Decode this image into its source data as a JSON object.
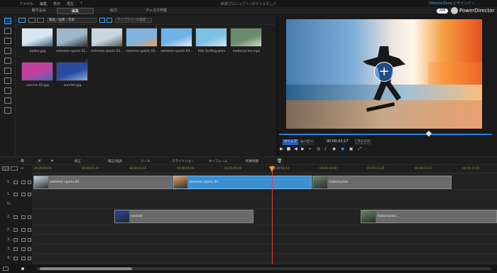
{
  "titlebar": {
    "menu": [
      "ファイル",
      "編集",
      "表示",
      "再生",
      "?"
    ],
    "title": "新規プロジェクト (タイトルなし)*",
    "directorzone": "DirectorZone にサインイン"
  },
  "modes": {
    "tabs": [
      "取り込み",
      "編集",
      "出力",
      "ディスク作成"
    ],
    "active": "編集"
  },
  "brand": {
    "badge": "APP",
    "name": "PowerDirector"
  },
  "library": {
    "filter": "動画・画像・音楽",
    "search_placeholder": "ライブラリーの検索",
    "items": [
      {
        "name": "ballon.jpg",
        "colors": [
          "#d8e6ef",
          "#3a5f7a"
        ],
        "check": false
      },
      {
        "name": "extreme sports 01...",
        "colors": [
          "#9bb7c8",
          "#303030"
        ],
        "check": false
      },
      {
        "name": "extreme sports 02...",
        "colors": [
          "#c8d6e0",
          "#5a5a4a"
        ],
        "check": false
      },
      {
        "name": "extreme sports 03...",
        "colors": [
          "#7fb3e0",
          "#e8a060"
        ],
        "check": true
      },
      {
        "name": "extreme sports 04...",
        "colors": [
          "#6fb2e8",
          "#e8eef2"
        ],
        "check": false
      },
      {
        "name": "Kite Surfing.wmv",
        "colors": [
          "#7cc1e6",
          "#d6e8ee"
        ],
        "check": false
      },
      {
        "name": "motorcycles.mpo",
        "colors": [
          "#6a8a6a",
          "#d0d8c0"
        ],
        "check": false
      },
      {
        "name": "sunrise 01.jpg",
        "colors": [
          "#c040a0",
          "#3a6ec0"
        ],
        "check": false
      },
      {
        "name": "sunrise.jpg",
        "colors": [
          "#2a4aa0",
          "#90a8d8"
        ],
        "check": true
      }
    ]
  },
  "preview": {
    "clip_label": "クリップ",
    "movie_label": "ムービー",
    "timecode": "00;00;03;17",
    "zoom": "フィット"
  },
  "edit_toolbar": {
    "items": [
      "修正",
      "補正/強調",
      "ツール",
      "スライドショー",
      "キーフレーム",
      "所要時間"
    ]
  },
  "timeline": {
    "ticks": [
      "00;00;00;00",
      "00;00;01;20",
      "00;00;03;10",
      "00;00;05;00",
      "00;00;06;20",
      "00;00;08;10",
      "00;00;10;00",
      "00;00;11;20",
      "00;00;13;10",
      "00;00;15;00"
    ],
    "tracks": [
      {
        "label": "1.",
        "type": "video"
      },
      {
        "label": "1.",
        "type": "audio"
      },
      {
        "label": "fx",
        "type": "fx"
      },
      {
        "label": "2.",
        "type": "video"
      },
      {
        "label": "2.",
        "type": "audio"
      },
      {
        "label": "3.",
        "type": "video"
      },
      {
        "label": "3.",
        "type": "audio"
      },
      {
        "label": "4.",
        "type": "video"
      }
    ],
    "clips": [
      {
        "track": 0,
        "name": "extreme sports 02",
        "color": "#6a6a6a",
        "thumb": "#c8d6e0"
      },
      {
        "track": 0,
        "name": "extreme sports 03",
        "color": "#3d8fd0",
        "thumb": "#e8a060",
        "selected": true
      },
      {
        "track": 0,
        "name": "motorcycles",
        "color": "#6a6a6a",
        "thumb": "#6a8a6a"
      },
      {
        "track": 3,
        "name": "sunrise",
        "color": "#6a6a6a",
        "thumb": "#2a4aa0"
      },
      {
        "track": 3,
        "name": "motorcycles",
        "color": "#6a6a6a",
        "thumb": "#6a8a6a"
      }
    ]
  }
}
